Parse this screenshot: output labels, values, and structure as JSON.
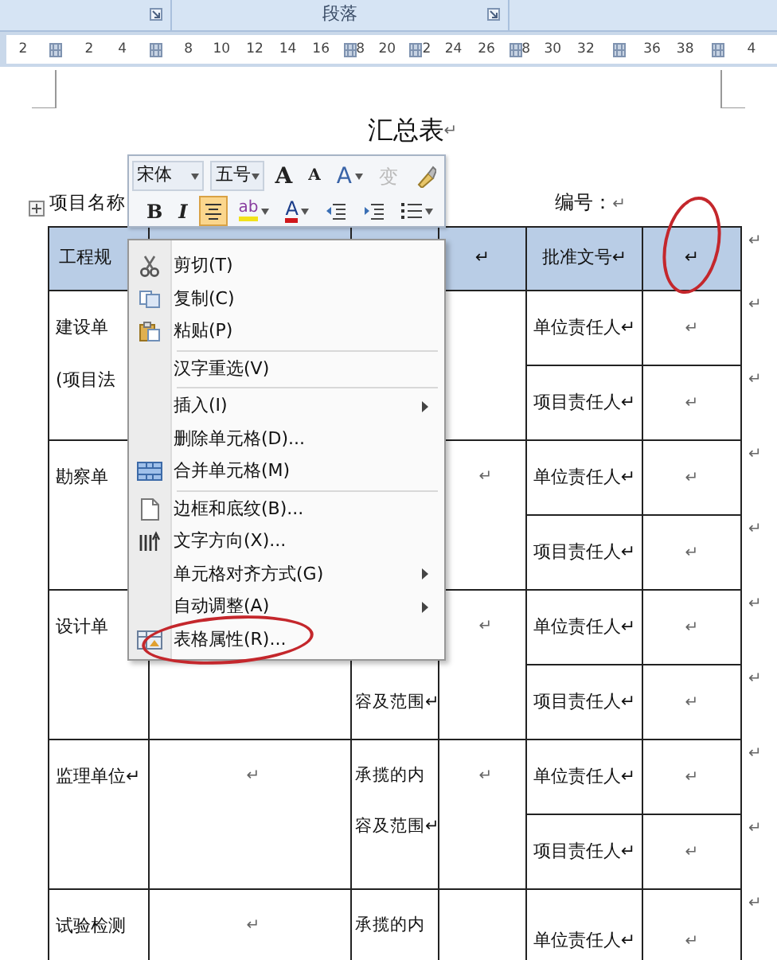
{
  "ribbon": {
    "group_label": "段落"
  },
  "ruler": [
    {
      "kind": "number",
      "label": "2"
    },
    {
      "kind": "marker"
    },
    {
      "kind": "number",
      "label": "2"
    },
    {
      "kind": "number",
      "label": "4"
    },
    {
      "kind": "marker"
    },
    {
      "kind": "number",
      "label": "8"
    },
    {
      "kind": "number",
      "label": "10"
    },
    {
      "kind": "number",
      "label": "12"
    },
    {
      "kind": "number",
      "label": "14"
    },
    {
      "kind": "number",
      "label": "16"
    },
    {
      "kind": "marker",
      "label": "8"
    },
    {
      "kind": "number",
      "label": "20"
    },
    {
      "kind": "marker",
      "label": "2"
    },
    {
      "kind": "number",
      "label": "24"
    },
    {
      "kind": "number",
      "label": "26"
    },
    {
      "kind": "marker",
      "label": "8"
    },
    {
      "kind": "number",
      "label": "30"
    },
    {
      "kind": "number",
      "label": "32"
    },
    {
      "kind": "marker"
    },
    {
      "kind": "number",
      "label": "36"
    },
    {
      "kind": "number",
      "label": "38"
    },
    {
      "kind": "marker"
    },
    {
      "kind": "number",
      "label": "4"
    }
  ],
  "document": {
    "title": "汇总表",
    "title_mark": "↵",
    "project_label": "项目名称",
    "number_label": "编号：",
    "number_mark": "↵"
  },
  "table": {
    "header": {
      "cells": [
        {
          "text": "工程规"
        },
        {},
        {},
        {
          "text": "↵"
        },
        {
          "text": "批准文号↵"
        },
        {
          "text": "↵",
          "circled": true
        }
      ],
      "end_mark": "↵"
    },
    "groups": [
      {
        "unit": {
          "line_1": "建设单",
          "line_2": "(项目法"
        },
        "rows": [
          {
            "role": "单位责任人↵",
            "value": "↵",
            "end_mark": "↵"
          },
          {
            "role": "项目责任人↵",
            "value": "↵",
            "end_mark": "↵"
          }
        ]
      },
      {
        "unit": {
          "line_1": "勘察单"
        },
        "col_4": "↵",
        "rows": [
          {
            "role": "单位责任人↵",
            "value": "↵",
            "end_mark": "↵"
          },
          {
            "role": "项目责任人↵",
            "value": "↵",
            "end_mark": "↵"
          }
        ]
      },
      {
        "unit": {
          "line_1": "设计单"
        },
        "scope": {
          "line_2": "容及范围↵"
        },
        "col_4": "↵",
        "rows": [
          {
            "role": "单位责任人↵",
            "value": "↵",
            "end_mark": "↵"
          },
          {
            "role": "项目责任人↵",
            "value": "↵",
            "end_mark": "↵"
          }
        ]
      },
      {
        "unit": {
          "line_1": "监理单位↵"
        },
        "col_2": "↵",
        "scope": {
          "line_1": "承揽的内",
          "line_2": "容及范围↵"
        },
        "col_4": "↵",
        "rows": [
          {
            "role": "单位责任人↵",
            "value": "↵",
            "end_mark": "↵"
          },
          {
            "role": "项目责任人↵",
            "value": "↵",
            "end_mark": "↵"
          }
        ]
      },
      {
        "unit": {
          "line_1": "试验检测"
        },
        "col_2": "↵",
        "scope": {
          "line_1": "承揽的内"
        },
        "rows": [
          {
            "role": "单位责任人↵",
            "value": "↵",
            "end_mark": "↵"
          }
        ]
      }
    ]
  },
  "mini_toolbar": {
    "font": "宋体",
    "size": "五号",
    "rows": [
      [
        {
          "kind": "grow",
          "label": "A",
          "disabled": false
        },
        {
          "kind": "shrink",
          "label": "A",
          "disabled": false
        },
        {
          "kind": "styles",
          "label": "A",
          "dropdown": true,
          "disabled": false
        },
        {
          "kind": "phonetic",
          "label": "变",
          "disabled": true
        },
        {
          "kind": "painter",
          "disabled": false
        }
      ],
      [
        {
          "kind": "bold",
          "label": "B",
          "selected": false
        },
        {
          "kind": "italic",
          "label": "I",
          "selected": false
        },
        {
          "kind": "center",
          "selected": true
        },
        {
          "kind": "highlight",
          "label": "ab",
          "dropdown": true
        },
        {
          "kind": "color",
          "label": "A",
          "dropdown": true
        },
        {
          "kind": "outdent"
        },
        {
          "kind": "indent"
        },
        {
          "kind": "bullets",
          "dropdown": true
        }
      ]
    ]
  },
  "context_menu": {
    "groups": [
      [
        {
          "kind": "cut",
          "label": "剪切(T)"
        },
        {
          "kind": "copy",
          "label": "复制(C)"
        },
        {
          "kind": "paste",
          "label": "粘贴(P)"
        }
      ],
      [
        {
          "kind": "plain",
          "label": "汉字重选(V)"
        }
      ],
      [
        {
          "kind": "plain",
          "label": "插入(I)",
          "submenu": true
        },
        {
          "kind": "plain",
          "label": "删除单元格(D)..."
        },
        {
          "kind": "merge",
          "label": "合并单元格(M)"
        }
      ],
      [
        {
          "kind": "borders",
          "label": "边框和底纹(B)..."
        },
        {
          "kind": "direction",
          "label": "文字方向(X)..."
        },
        {
          "kind": "plain",
          "label": "单元格对齐方式(G)",
          "submenu": true
        },
        {
          "kind": "plain",
          "label": "自动调整(A)",
          "submenu": true
        },
        {
          "kind": "properties",
          "label": "表格属性(R)...",
          "circled": true
        }
      ]
    ]
  }
}
